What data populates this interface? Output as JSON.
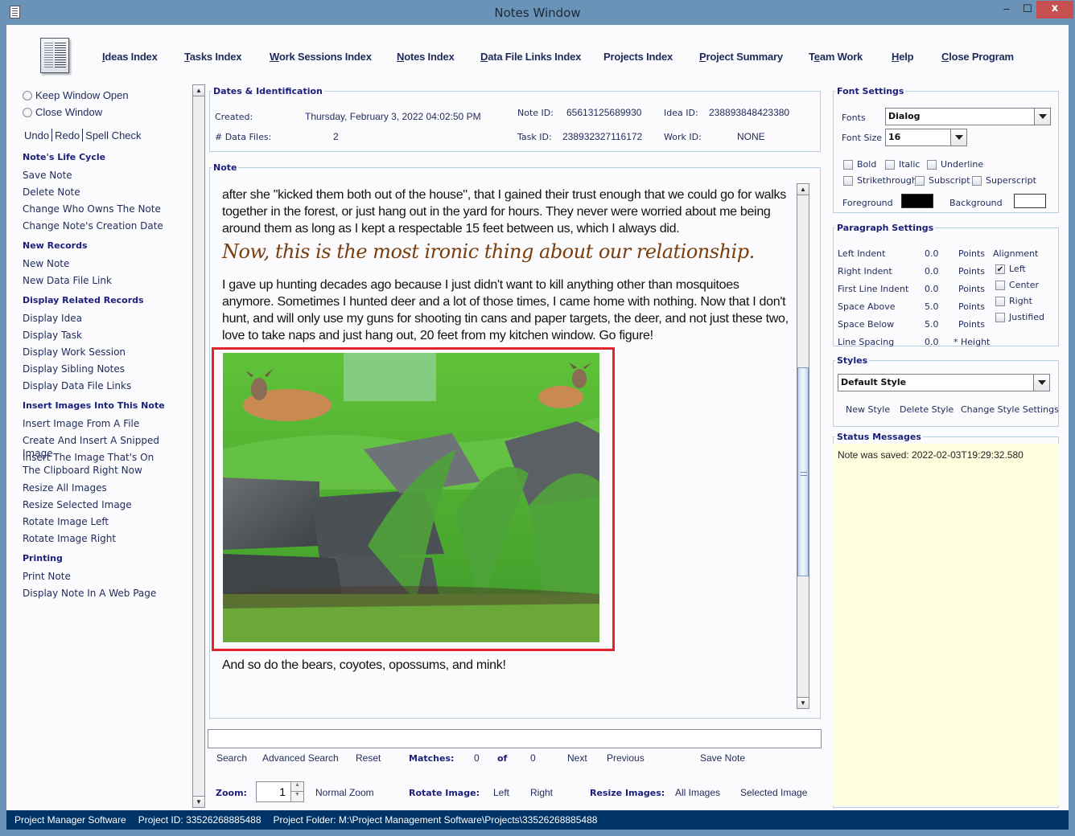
{
  "window": {
    "title": "Notes Window",
    "minimize": "–",
    "maximize": "☐",
    "close": "x"
  },
  "topnav": {
    "items": [
      {
        "label": "Ideas Index",
        "mnemonic": "I"
      },
      {
        "label": "Tasks Index",
        "mnemonic": "T"
      },
      {
        "label": "Work Sessions Index",
        "mnemonic": "W"
      },
      {
        "label": "Notes Index",
        "mnemonic": "N"
      },
      {
        "label": "Data File Links Index",
        "mnemonic": "D"
      },
      {
        "label": "Projects Index",
        "mnemonic": ""
      },
      {
        "label": "Project Summary",
        "mnemonic": "P"
      },
      {
        "label": "Team Work",
        "mnemonic": "e"
      },
      {
        "label": "Help",
        "mnemonic": "H"
      },
      {
        "label": "Close Program",
        "mnemonic": "C"
      }
    ]
  },
  "left": {
    "radios": [
      {
        "label": "Keep Window Open",
        "selected": false
      },
      {
        "label": "Close Window",
        "selected": false
      }
    ],
    "edit_actions": [
      "Undo",
      "Redo",
      "Spell Check"
    ],
    "sections": [
      {
        "heading": "Note's Life Cycle",
        "items": [
          "Save Note",
          "Delete Note",
          "Change Who Owns The Note",
          "Change Note's Creation Date"
        ]
      },
      {
        "heading": "New Records",
        "items": [
          "New Note",
          "New Data File Link"
        ]
      },
      {
        "heading": "Display Related Records",
        "items": [
          "Display Idea",
          "Display Task",
          "Display Work Session",
          "Display Sibling Notes",
          "Display Data File Links"
        ]
      },
      {
        "heading": "Insert Images Into This Note",
        "items": [
          "Insert Image From A File",
          "Create And Insert A Snipped Image",
          "Insert The Image That's On The Clipboard Right Now",
          "Resize All Images",
          "Resize Selected Image",
          "Rotate Image Left",
          "Rotate Image Right"
        ]
      },
      {
        "heading": "Printing",
        "items": [
          "Print Note",
          "Display Note In A Web Page"
        ]
      }
    ]
  },
  "dates": {
    "legend": "Dates & Identification",
    "created_label": "Created:",
    "created_value": "Thursday, February 3, 2022   04:02:50 PM",
    "data_files_label": "# Data Files:",
    "data_files_value": "2",
    "note_id_label": "Note ID:",
    "note_id_value": "65613125689930",
    "idea_id_label": "Idea ID:",
    "idea_id_value": "238893848423380",
    "task_id_label": "Task ID:",
    "task_id_value": "238932327116172",
    "work_id_label": "Work ID:",
    "work_id_value": "NONE"
  },
  "note": {
    "legend": "Note",
    "para1": "after she \"kicked them both out of the house\", that I gained their trust enough that we could go for walks together in the forest, or just hang out in the yard for hours. They never were worried about me being around them as long as I kept a respectable 15 feet between us, which I always did.",
    "heading": "Now, this is the most ironic thing about our relationship.",
    "para2": "I gave up hunting decades ago because I just didn't want to kill anything other than mosquitoes anymore. Sometimes I hunted deer and a lot of those times, I came home with nothing. Now that I don't hunt, and will only use my guns for shooting tin cans and paper targets, the deer, and not just these two, love to take naps and just hang out, 20 feet from my kitchen window. Go figure!",
    "image_alt": "Two deer resting in grass behind a stone wall with ferns",
    "para3": "And so do the bears, coyotes, opossums, and mink!",
    "scroll_position": 0.68
  },
  "search": {
    "value": "",
    "search_label": "Search",
    "advanced_label": "Advanced Search",
    "reset_label": "Reset",
    "matches_label": "Matches:",
    "matches_value": "0",
    "of_label": "of",
    "total_value": "0",
    "next_label": "Next",
    "previous_label": "Previous",
    "save_label": "Save Note"
  },
  "zoom": {
    "label": "Zoom:",
    "value": "1",
    "normal_label": "Normal Zoom",
    "rotate_label": "Rotate Image:",
    "rotate_left": "Left",
    "rotate_right": "Right",
    "resize_label": "Resize Images:",
    "resize_all": "All Images",
    "resize_selected": "Selected Image"
  },
  "font_settings": {
    "legend": "Font Settings",
    "fonts_label": "Fonts",
    "font_value": "Dialog",
    "size_label": "Font Size",
    "size_value": "16",
    "checks": [
      "Bold",
      "Italic",
      "Underline",
      "Strikethrough",
      "Subscript",
      "Superscript"
    ],
    "foreground_label": "Foreground",
    "foreground_color": "#000000",
    "background_label": "Background",
    "background_color": "#ffffff"
  },
  "paragraph": {
    "legend": "Paragraph Settings",
    "rows": [
      {
        "label": "Left Indent",
        "value": "0.0",
        "unit": "Points"
      },
      {
        "label": "Right Indent",
        "value": "0.0",
        "unit": "Points"
      },
      {
        "label": "First Line Indent",
        "value": "0.0",
        "unit": "Points"
      },
      {
        "label": "Space Above",
        "value": "5.0",
        "unit": "Points"
      },
      {
        "label": "Space Below",
        "value": "5.0",
        "unit": "Points"
      },
      {
        "label": "Line Spacing",
        "value": "0.0",
        "unit": "* Height"
      }
    ],
    "alignment_label": "Alignment",
    "alignments": [
      {
        "label": "Left",
        "checked": true
      },
      {
        "label": "Center",
        "checked": false
      },
      {
        "label": "Right",
        "checked": false
      },
      {
        "label": "Justified",
        "checked": false
      }
    ]
  },
  "styles": {
    "legend": "Styles",
    "selected": "Default Style",
    "new_label": "New Style",
    "delete_label": "Delete Style",
    "change_label": "Change Style Settings"
  },
  "status": {
    "legend": "Status Messages",
    "message": "Note was saved:  2022-02-03T19:29:32.580"
  },
  "statusbar": {
    "app": "Project Manager Software",
    "project_id": "Project ID:  33526268885488",
    "project_folder": "Project Folder: M:\\Project Management Software\\Projects\\33526268885488"
  },
  "colors": {
    "accent_frame": "#e2222c",
    "statusbar_bg": "#003366",
    "status_msg_bg": "#ffffe0",
    "heading_color": "#7a3e0e"
  }
}
